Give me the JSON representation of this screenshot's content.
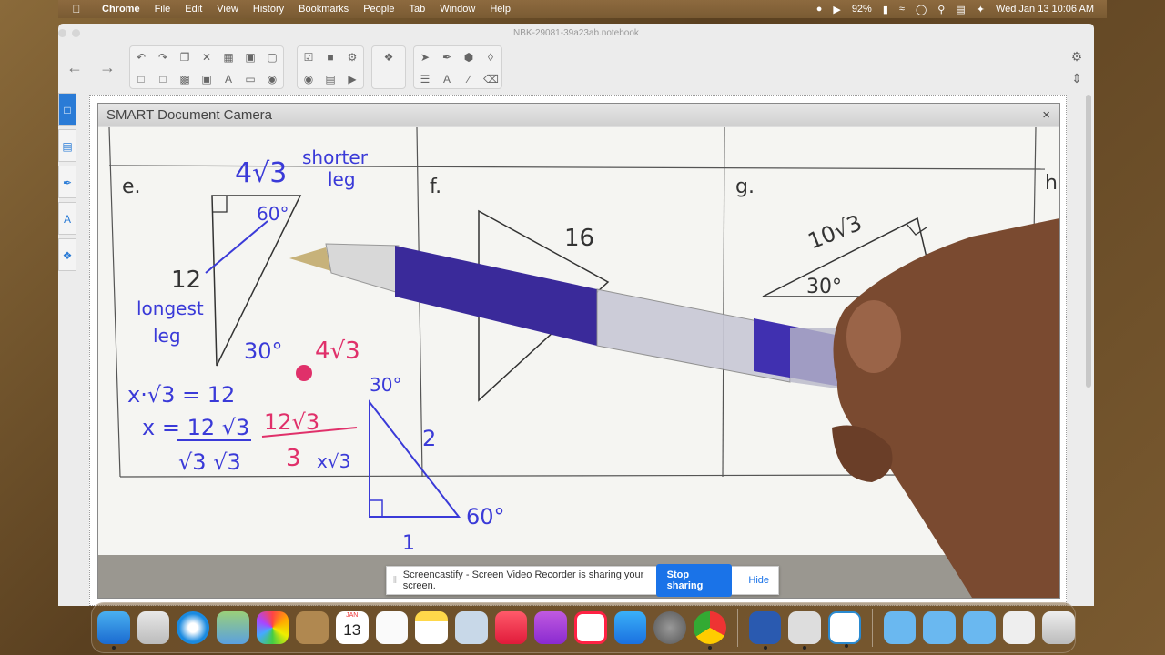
{
  "menubar": {
    "app": "Chrome",
    "items": [
      "File",
      "Edit",
      "View",
      "History",
      "Bookmarks",
      "People",
      "Tab",
      "Window",
      "Help"
    ],
    "battery": "92%",
    "datetime": "Wed Jan 13  10:06 AM"
  },
  "window": {
    "title": "NBK-29081-39a23ab.notebook"
  },
  "camera_panel": {
    "title": "SMART Document Camera",
    "close": "×"
  },
  "worksheet": {
    "problems": {
      "e": "e.",
      "f": "f.",
      "g": "g.",
      "h": "h"
    },
    "e_annotations": {
      "side": "4√3",
      "shorter": "shorter",
      "leg": "leg",
      "angle60": "60°",
      "hyp": "12",
      "longest": "longest",
      "leg2": "leg",
      "angle30": "30°",
      "eq1": "x·√3 = 12",
      "eq2": "x = 12  √3",
      "eq2b": "√3  √3",
      "red1": "12√3",
      "red2": "3",
      "red_answer": "4√3",
      "ref30": "30°",
      "ref2": "2",
      "ref60": "60°",
      "ref1": "1",
      "refx": "x√3"
    },
    "f_label": "16",
    "g_side": "10√3",
    "g_angle": "30°"
  },
  "screencastify": {
    "message": "Screencastify - Screen Video Recorder is sharing your screen.",
    "stop": "Stop sharing",
    "hide": "Hide"
  },
  "dock": {
    "calendar_month": "JAN",
    "calendar_day": "13",
    "apps": [
      "Finder",
      "Launchpad",
      "Safari",
      "Maps",
      "Photos",
      "Contacts",
      "Calendar",
      "Reminders",
      "Notes",
      "Preview",
      "Music",
      "Podcasts",
      "News",
      "App Store",
      "System Preferences",
      "Chrome",
      "Word",
      "Document Camera",
      "Notebook",
      "Documents",
      "Applications",
      "Downloads",
      "Screencastify",
      "Trash"
    ]
  },
  "colors": {
    "accent": "#1a73e8",
    "blue_ink": "#3a3ad8",
    "red_ink": "#e0306a",
    "pen": "#3a2a9a"
  }
}
